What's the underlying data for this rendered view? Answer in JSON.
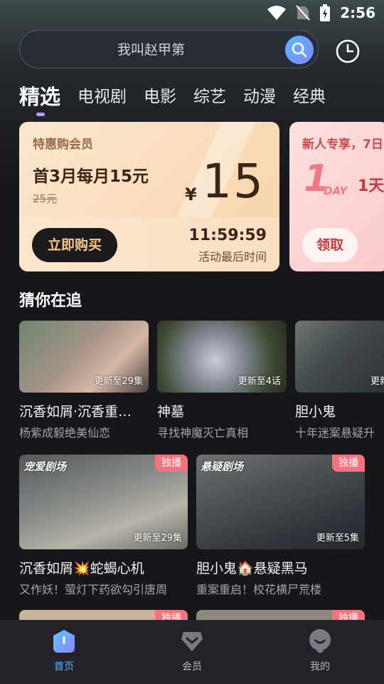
{
  "status_bar": {
    "time": "2:56"
  },
  "search": {
    "placeholder_text": "我叫赵甲第"
  },
  "tabs": [
    {
      "label": "精选",
      "active": true
    },
    {
      "label": "电视剧"
    },
    {
      "label": "电影"
    },
    {
      "label": "综艺"
    },
    {
      "label": "动漫"
    },
    {
      "label": "经典"
    }
  ],
  "promo_vip": {
    "title": "特惠购会员",
    "headline": "首3月每月15元",
    "old_price": "25元",
    "currency": "¥",
    "price": "15",
    "buy_label": "立即购买",
    "countdown": "11:59:59",
    "countdown_label": "活动最后时间"
  },
  "promo_newbie": {
    "title": "新人专享，7日",
    "big_number": "1",
    "day_text": "DAY",
    "side_text": "1天",
    "button_label": "领取"
  },
  "section": {
    "title": "猜你在追"
  },
  "small_cards": [
    {
      "title": "沉香如屑·沉香重…",
      "subtitle": "杨紫成毅绝美仙恋",
      "update": "更新至29集"
    },
    {
      "title": "神墓",
      "subtitle": "寻找神魔灭亡真相",
      "update": "更新至4话"
    },
    {
      "title": "胆小鬼",
      "subtitle": "十年迷案悬疑升",
      "update": "更新"
    }
  ],
  "large_cards": [
    {
      "title": "沉香如屑💥蛇蝎心机",
      "subtitle": "又作妖！萤灯下药欲勾引唐周",
      "update": "更新至29集",
      "badge": "独播",
      "logo": "宠爱剧场"
    },
    {
      "title": "胆小鬼🏠悬疑黑马",
      "subtitle": "重案重启！校花横尸荒楼",
      "update": "更新至5集",
      "badge": "独播",
      "logo": "悬疑剧场"
    }
  ],
  "peek_cards": [
    {
      "badge": "独播"
    },
    {
      "badge": "独播"
    }
  ],
  "bottom_nav": [
    {
      "label": "首页",
      "active": true
    },
    {
      "label": "会员"
    },
    {
      "label": "我的"
    }
  ],
  "colors": {
    "accent": "#55b7ff",
    "exclusive_badge": "#f4737d",
    "background": "#17161b"
  }
}
